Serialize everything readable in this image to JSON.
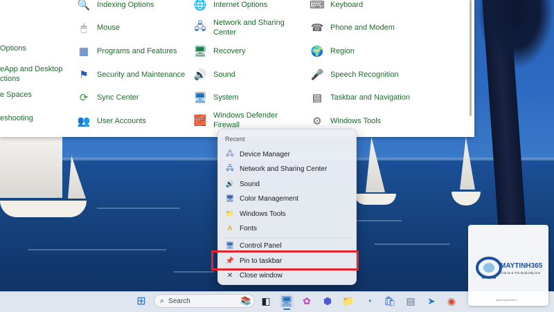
{
  "control_panel": {
    "items": [
      {
        "label": "Indexing Options",
        "icon": "indexing-icon"
      },
      {
        "label": "Internet Options",
        "icon": "internet-options-icon"
      },
      {
        "label": "Keyboard",
        "icon": "keyboard-icon"
      },
      {
        "label": "Mouse",
        "icon": "mouse-icon"
      },
      {
        "label": "Network and Sharing\nCenter",
        "icon": "network-icon"
      },
      {
        "label": "Phone and Modem",
        "icon": "phone-modem-icon"
      },
      {
        "label": "Options",
        "icon": "none"
      },
      {
        "label": "Programs and Features",
        "icon": "programs-icon"
      },
      {
        "label": "Recovery",
        "icon": "recovery-icon"
      },
      {
        "label": "Region",
        "icon": "region-icon"
      },
      {
        "label": "eApp and Desktop\nctions",
        "icon": "none"
      },
      {
        "label": "Security and Maintenance",
        "icon": "security-flag-icon"
      },
      {
        "label": "Sound",
        "icon": "speaker-icon"
      },
      {
        "label": "Speech Recognition",
        "icon": "microphone-icon"
      },
      {
        "label": "e Spaces",
        "icon": "none"
      },
      {
        "label": "Sync Center",
        "icon": "sync-icon"
      },
      {
        "label": "System",
        "icon": "system-monitor-icon"
      },
      {
        "label": "Taskbar and Navigation",
        "icon": "taskbar-icon"
      },
      {
        "label": "eshooting",
        "icon": "none"
      },
      {
        "label": "User Accounts",
        "icon": "users-icon"
      },
      {
        "label": "Windows Defender\nFirewall",
        "icon": "firewall-icon"
      },
      {
        "label": "Windows Tools",
        "icon": "gear-tools-icon"
      }
    ]
  },
  "jumplist": {
    "section_label": "Recent",
    "recent": [
      {
        "label": "Device Manager",
        "icon": "device-manager-icon"
      },
      {
        "label": "Network and Sharing Center",
        "icon": "network-icon"
      },
      {
        "label": "Sound",
        "icon": "speaker-icon"
      },
      {
        "label": "Color Management",
        "icon": "color-management-icon"
      },
      {
        "label": "Windows Tools",
        "icon": "folder-icon"
      },
      {
        "label": "Fonts",
        "icon": "fonts-icon"
      }
    ],
    "tasks": [
      {
        "label": "Control Panel",
        "icon": "control-panel-icon"
      },
      {
        "label": "Pin to taskbar",
        "icon": "pin-icon"
      },
      {
        "label": "Close window",
        "icon": "close-icon"
      }
    ],
    "highlight_color": "#e1232b"
  },
  "taskbar": {
    "search_placeholder": "Search",
    "icons": [
      "windows-start-icon",
      "search-icon",
      "books-icon",
      "task-view-icon",
      "control-panel-icon",
      "copilot-icon",
      "teams-icon",
      "file-explorer-icon",
      "edge-icon",
      "store-icon",
      "notepad-icon",
      "maps-icon",
      "chrome-icon"
    ]
  },
  "watermark": {
    "brand": "MAYTINH365",
    "tagline": "Chia sẻ & Thủ thuật Máy tính",
    "bottom_text": "www.maytinh365.vn"
  }
}
